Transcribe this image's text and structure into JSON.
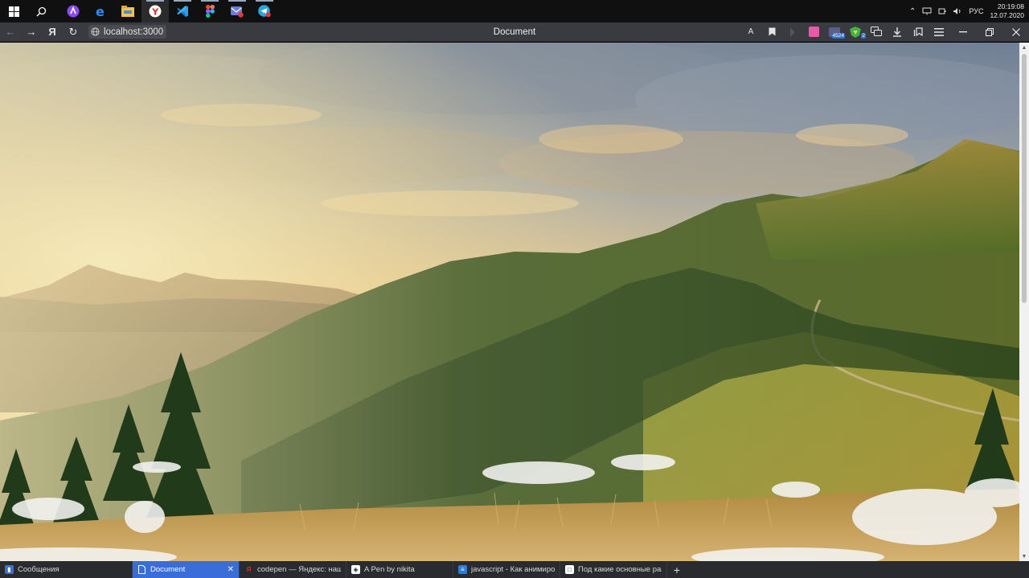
{
  "taskbar": {
    "apps": [
      {
        "name": "windows-start",
        "icon": "windows-logo-icon"
      },
      {
        "name": "search",
        "icon": "search-icon"
      },
      {
        "name": "alice",
        "icon": "alice-assistant-icon"
      },
      {
        "name": "edge",
        "icon": "edge-icon"
      },
      {
        "name": "explorer",
        "icon": "folder-icon"
      },
      {
        "name": "yandex-browser",
        "icon": "yandex-browser-icon"
      },
      {
        "name": "vscode",
        "icon": "vscode-icon"
      },
      {
        "name": "figma",
        "icon": "figma-icon"
      },
      {
        "name": "mail",
        "icon": "mail-icon"
      },
      {
        "name": "telegram",
        "icon": "telegram-icon"
      }
    ],
    "tray": {
      "lang": "РУС",
      "time": "20:19:08",
      "date": "12.07.2020"
    }
  },
  "browser": {
    "url": "localhost:3000",
    "page_title": "Document",
    "translate_glyph": "A",
    "reader_glyph": "Я",
    "extension_badge_1": "4524",
    "extension_badge_2": "2"
  },
  "tabs": [
    {
      "title": "Сообщения",
      "favicon": "messages-icon",
      "color": "#3d6fd1",
      "active": false
    },
    {
      "title": "Document",
      "favicon": "document-icon",
      "color": "#ffffff",
      "active": true
    },
    {
      "title": "codepen — Яндекс: нашло",
      "favicon": "yandex-icon",
      "color": "#e52620",
      "active": false
    },
    {
      "title": "A Pen by nikita",
      "favicon": "codepen-icon",
      "color": "#ffffff",
      "active": false
    },
    {
      "title": "javascript - Как анимирова",
      "favicon": "stackoverflow-icon",
      "color": "#2e7bd8",
      "active": false
    },
    {
      "title": "Под какие основные раз",
      "favicon": "page-icon",
      "color": "#ffffff",
      "active": false
    }
  ],
  "colors": {
    "taskbar_bg": "#101010",
    "toolbar_bg": "#3a3b40",
    "active_tab": "#3b6dd8"
  }
}
